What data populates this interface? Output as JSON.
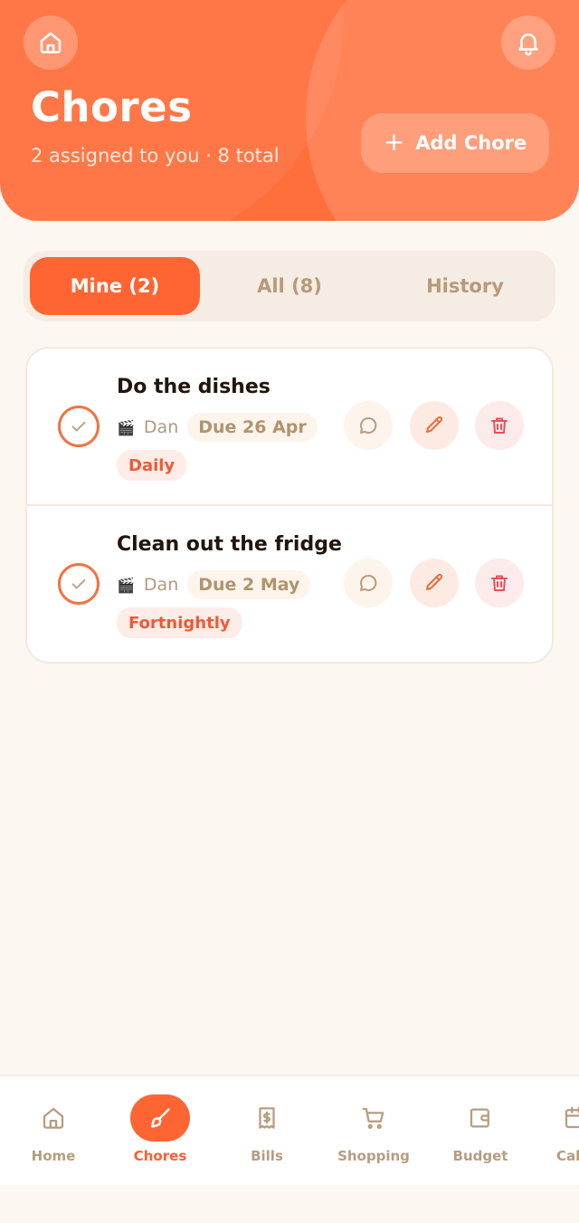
{
  "header": {
    "title": "Chores",
    "subtitle": "2 assigned to you · 8 total",
    "add_button": "Add Chore",
    "home_icon": "home-icon",
    "bell_icon": "bell-icon",
    "accent": "#ff6f3c"
  },
  "tabs": [
    {
      "label": "Mine (2)",
      "active": true
    },
    {
      "label": "All (8)",
      "active": false
    },
    {
      "label": "History",
      "active": false
    }
  ],
  "chores": [
    {
      "title": "Do the dishes",
      "avatar": "🎬",
      "assignee": "Dan",
      "due": "Due 26 Apr",
      "frequency": "Daily"
    },
    {
      "title": "Clean out the fridge",
      "avatar": "🎬",
      "assignee": "Dan",
      "due": "Due 2 May",
      "frequency": "Fortnightly"
    }
  ],
  "nav": [
    {
      "label": "Home",
      "icon": "home-icon",
      "active": false
    },
    {
      "label": "Chores",
      "icon": "brush-icon",
      "active": true
    },
    {
      "label": "Bills",
      "icon": "receipt-icon",
      "active": false
    },
    {
      "label": "Shopping",
      "icon": "cart-icon",
      "active": false
    },
    {
      "label": "Budget",
      "icon": "wallet-icon",
      "active": false
    },
    {
      "label": "Cal",
      "icon": "calendar-icon",
      "active": false
    }
  ]
}
